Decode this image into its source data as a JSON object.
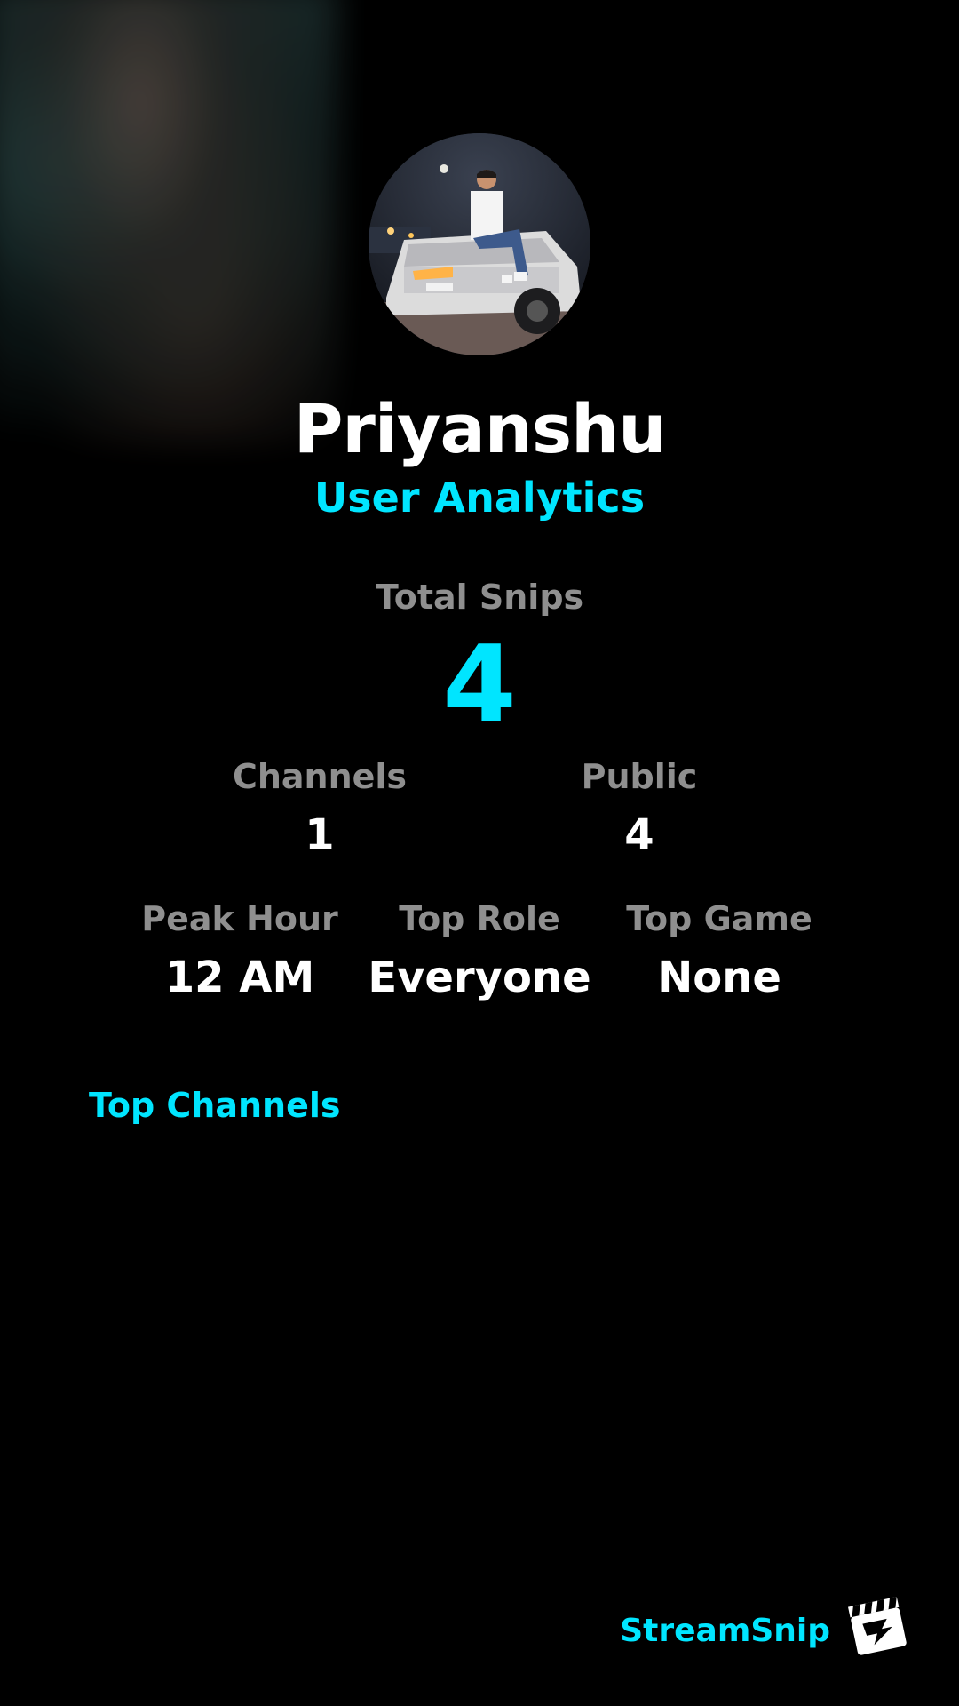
{
  "profile": {
    "name": "Priyanshu",
    "subtitle": "User Analytics"
  },
  "stats": {
    "total_snips_label": "Total Snips",
    "total_snips_value": "4",
    "channels_label": "Channels",
    "channels_value": "1",
    "public_label": "Public",
    "public_value": "4",
    "peak_hour_label": "Peak Hour",
    "peak_hour_value": "12 AM",
    "top_role_label": "Top Role",
    "top_role_value": "Everyone",
    "top_game_label": "Top Game",
    "top_game_value": "None"
  },
  "sections": {
    "top_channels_title": "Top Channels"
  },
  "branding": {
    "name": "StreamSnip",
    "logo_icon": "clapperboard-icon"
  },
  "colors": {
    "background": "#000000",
    "accent": "#00e5ff",
    "label_gray": "#8f8f8f",
    "value_white": "#ffffff"
  }
}
